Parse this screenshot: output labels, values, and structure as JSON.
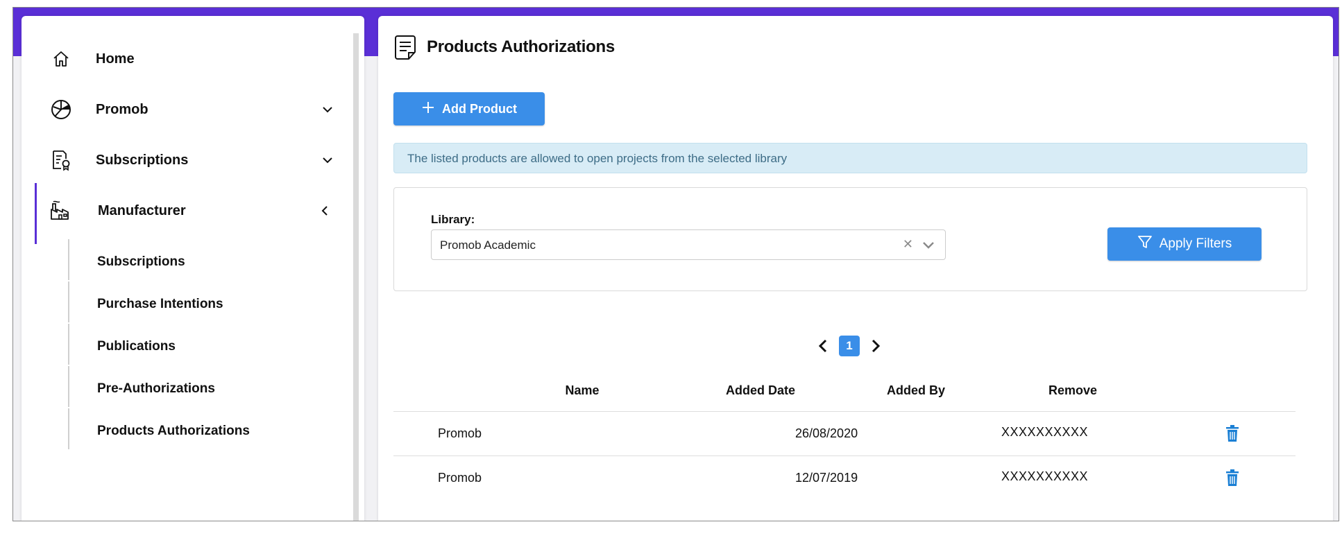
{
  "sidebar": {
    "items": [
      {
        "label": "Home",
        "icon": "home-icon"
      },
      {
        "label": "Promob",
        "icon": "promob-icon"
      },
      {
        "label": "Subscriptions",
        "icon": "subscriptions-icon"
      },
      {
        "label": "Manufacturer",
        "icon": "factory-icon"
      }
    ],
    "subitems": [
      {
        "label": "Subscriptions"
      },
      {
        "label": "Purchase Intentions"
      },
      {
        "label": "Publications"
      },
      {
        "label": "Pre-Authorizations"
      },
      {
        "label": "Products Authorizations"
      }
    ]
  },
  "main": {
    "title": "Products Authorizations",
    "add_button": "Add Product",
    "info": "The listed products are allowed to open projects from the selected library",
    "filter": {
      "library_label": "Library:",
      "library_value": "Promob Academic",
      "apply_label": "Apply Filters"
    },
    "pagination": {
      "current_page": "1"
    },
    "table": {
      "columns": [
        "Name",
        "Added Date",
        "Added By",
        "Remove"
      ],
      "rows": [
        {
          "name": "Promob",
          "date": "26/08/2020",
          "by": "XXXXXXXXXX"
        },
        {
          "name": "Promob",
          "date": "12/07/2019",
          "by": "XXXXXXXXXX"
        }
      ]
    }
  },
  "colors": {
    "accent": "#5a2fd6",
    "primary_button": "#3a8ee8",
    "info_background": "#d8ecf6",
    "trash": "#1a7fd4"
  }
}
